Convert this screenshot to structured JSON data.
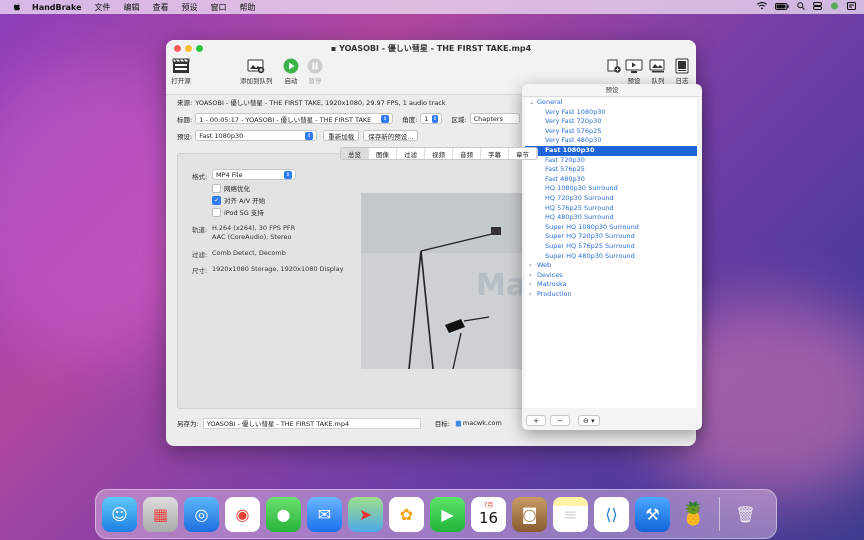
{
  "menubar": {
    "app": "HandBrake",
    "items": [
      "文件",
      "编辑",
      "查看",
      "预设",
      "窗口",
      "帮助"
    ]
  },
  "window": {
    "title": "YOASOBI - 優しい彗星 - THE FIRST TAKE.mp4",
    "toolbar": {
      "open": "打开源",
      "add_queue": "添加到队列",
      "start": "启动",
      "pause": "暂停",
      "right_labels": [
        "预设",
        "队列",
        "日志"
      ]
    },
    "source": {
      "label": "来源:",
      "value": "YOASOBI - 優しい彗星 - THE FIRST TAKE, 1920x1080, 29.97 FPS, 1 audio track"
    },
    "title_row": {
      "label": "标题:",
      "value": "1 - 00:05:17 - YOASOBI - 優しい彗星 - THE FIRST TAKE",
      "angle_label": "角度:",
      "angle_value": "1",
      "range_label": "区域:",
      "range_value": "Chapters"
    },
    "preset_row": {
      "label": "预设:",
      "value": "Fast 1080p30",
      "reload": "重新加载",
      "save_new": "保存新的预设..."
    },
    "tabs": [
      "总览",
      "图像",
      "过滤",
      "视频",
      "音频",
      "字幕",
      "章节"
    ],
    "summary": {
      "format_label": "格式:",
      "format_value": "MP4 File",
      "web_optimized": "网络优化",
      "align_av": "对齐 A/V 开始",
      "ipod": "iPod 5G 支持",
      "tracks_label": "轨道:",
      "tracks_line1": "H.264 (x264), 30 FPS PFR",
      "tracks_line2": "AAC (CoreAudio), Stereo",
      "filters_label": "过滤:",
      "filters_value": "Comb Detect, Decomb",
      "size_label": "尺寸:",
      "size_value": "1920x1080 Storage, 1920x1080 Display"
    },
    "save_as_label": "另存为:",
    "save_as_value": "YOASOBI - 優しい彗星 - THE FIRST TAKE.mp4",
    "dest_label": "目标:",
    "dest_value": "macwk.com"
  },
  "watermark": "MacWk.com",
  "presets_panel": {
    "title": "预设",
    "general": "General",
    "items": [
      "Very Fast 1080p30",
      "Very Fast 720p30",
      "Very Fast 576p25",
      "Very Fast 480p30",
      "Fast 1080p30",
      "Fast 720p30",
      "Fast 576p25",
      "Fast 480p30",
      "HQ 1080p30 Surround",
      "HQ 720p30 Surround",
      "HQ 576p25 Surround",
      "HQ 480p30 Surround",
      "Super HQ 1080p30 Surround",
      "Super HQ 720p30 Surround",
      "Super HQ 576p25 Surround",
      "Super HQ 480p30 Surround"
    ],
    "selected_index": 4,
    "groups": [
      "Web",
      "Devices",
      "Matroska",
      "Production"
    ],
    "add": "+",
    "remove": "−",
    "options": "⊖ ▾"
  },
  "dock": {
    "calendar_month": "7月",
    "calendar_day": "16"
  },
  "colors": {
    "accent": "#2f7cf6",
    "selection": "#1f63d8",
    "link": "#2b6fd8"
  }
}
